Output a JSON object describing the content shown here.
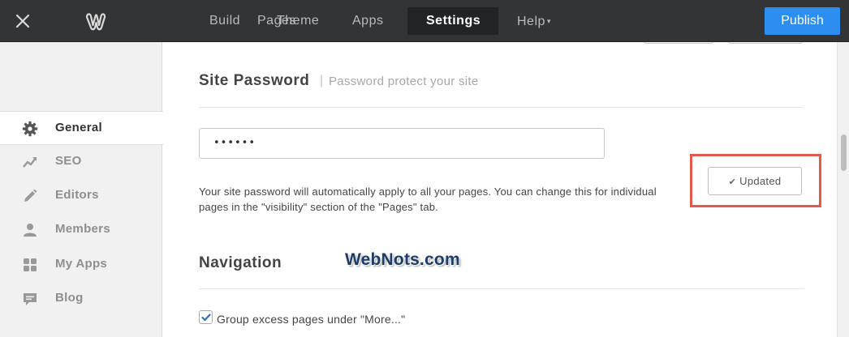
{
  "topbar": {
    "tabs": [
      {
        "label": "Build"
      },
      {
        "label": "Pages"
      },
      {
        "label": "Theme"
      },
      {
        "label": "Apps"
      },
      {
        "label": "Settings",
        "active": true
      },
      {
        "label": "Help"
      }
    ],
    "publish_label": "Publish",
    "accent_color": "#2d8ef2",
    "icons": {
      "close": "close-icon",
      "logo": "weebly-logo-icon"
    }
  },
  "sidebar": {
    "items": [
      {
        "label": "General",
        "icon": "gear-icon",
        "active": true
      },
      {
        "label": "SEO",
        "icon": "trend-chart-icon"
      },
      {
        "label": "Editors",
        "icon": "pencil-icon"
      },
      {
        "label": "Members",
        "icon": "person-icon"
      },
      {
        "label": "My Apps",
        "icon": "apps-grid-icon"
      },
      {
        "label": "Blog",
        "icon": "comment-icon"
      }
    ]
  },
  "main": {
    "site_password": {
      "title": "Site Password",
      "separator": "|",
      "subtitle": "Password protect your site",
      "input_value": "••••••",
      "description": "Your site password will automatically apply to all your pages. You can change this for individual pages in the \"visibility\" section of the \"Pages\" tab.",
      "status_button": "Updated",
      "highlight_color": "#e25a4c"
    },
    "navigation": {
      "title": "Navigation",
      "checkbox_label": "Group excess pages under \"More...\"",
      "checkbox_checked": true
    },
    "watermark": "WebNots.com"
  }
}
